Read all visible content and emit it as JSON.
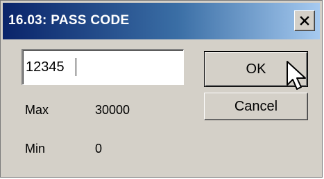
{
  "window": {
    "title": "16.03: PASS CODE",
    "close_glyph": "✕"
  },
  "pass_code": {
    "value": "12345",
    "placeholder": ""
  },
  "buttons": {
    "ok_label": "OK",
    "cancel_label": "Cancel"
  },
  "limits": {
    "max_label": "Max",
    "max_value": "30000",
    "min_label": "Min",
    "min_value": "0"
  },
  "icons": {
    "close": "close-icon",
    "cursor": "mouse-pointer-icon"
  },
  "colors": {
    "titlebar_start": "#0a246a",
    "titlebar_end": "#a6caf0",
    "dialog_face": "#d4d0c8",
    "title_text": "#ffffff"
  }
}
